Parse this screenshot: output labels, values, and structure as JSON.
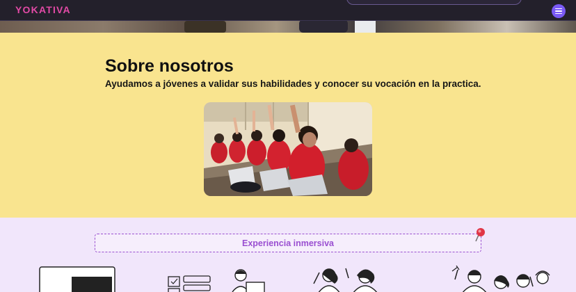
{
  "brand": {
    "logo_text": "YOKATIVA",
    "accent": "#e24aa6",
    "menu_color": "#7a5af5"
  },
  "about": {
    "title": "Sobre nosotros",
    "subtitle": "Ayudamos a jóvenes a validar sus habilidades y conocer su vocación en la practica.",
    "background": "#f9e48f"
  },
  "experience": {
    "label": "Experiencia inmersiva",
    "accent": "#9a4fd1"
  },
  "icons": {
    "menu": "hamburger-icon",
    "pin": "pushpin-icon"
  }
}
